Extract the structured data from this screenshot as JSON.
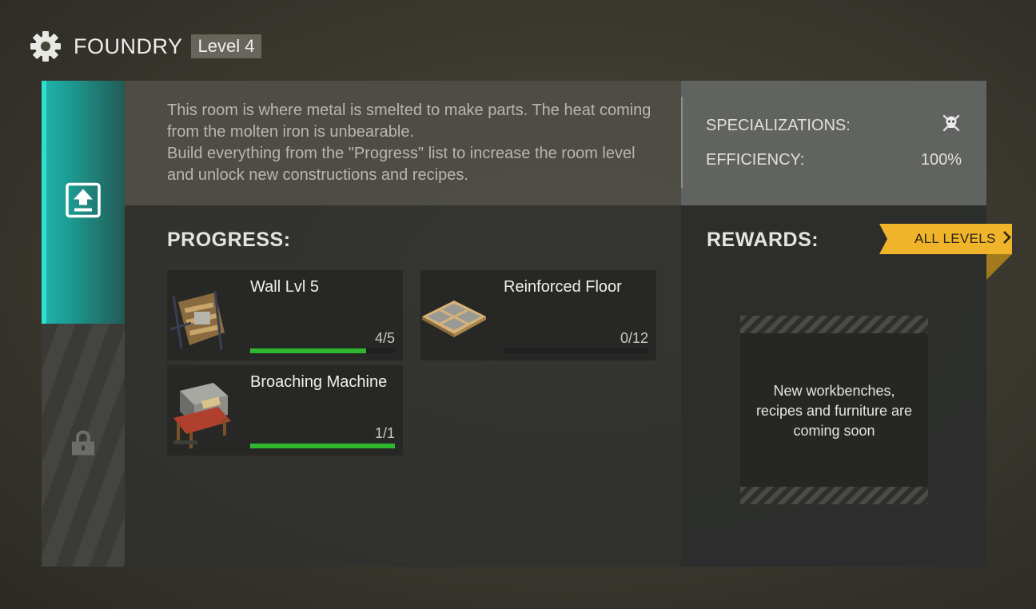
{
  "header": {
    "room_name": "FOUNDRY",
    "level": "Level 4"
  },
  "tabs": [
    {
      "name": "upgrade",
      "icon": "upgrade-arrow-icon",
      "active": true
    },
    {
      "name": "locked",
      "icon": "lock-icon",
      "active": false
    }
  ],
  "description": {
    "lines": [
      "This room is where metal is smelted to make parts. The heat coming from the molten iron is unbearable.",
      "Build everything from the \"Progress\" list to increase the room level and unlock new constructions and recipes."
    ]
  },
  "stats": {
    "specializations_label": "SPECIALIZATIONS:",
    "specializations_icon": "skull-crossbones-icon",
    "efficiency_label": "EFFICIENCY:",
    "efficiency_value": "100%"
  },
  "progress": {
    "title": "PROGRESS:",
    "items": [
      {
        "name": "Wall Lvl 5",
        "count": "4/5",
        "fraction": 0.8,
        "icon": "wall-construction-icon"
      },
      {
        "name": "Reinforced Floor",
        "count": "0/12",
        "fraction": 0.0,
        "icon": "floor-tile-icon"
      },
      {
        "name": "Broaching Machine",
        "count": "1/1",
        "fraction": 1.0,
        "icon": "broaching-machine-icon"
      }
    ]
  },
  "rewards": {
    "title": "REWARDS:",
    "all_levels_label": "ALL LEVELS",
    "coming_soon_lines": [
      "New workbenches,",
      "recipes and furniture are",
      "coming soon"
    ]
  },
  "colors": {
    "accent_teal": "#1fb5aa",
    "progress_green": "#2fb82f",
    "button_yellow": "#f0b42a"
  }
}
